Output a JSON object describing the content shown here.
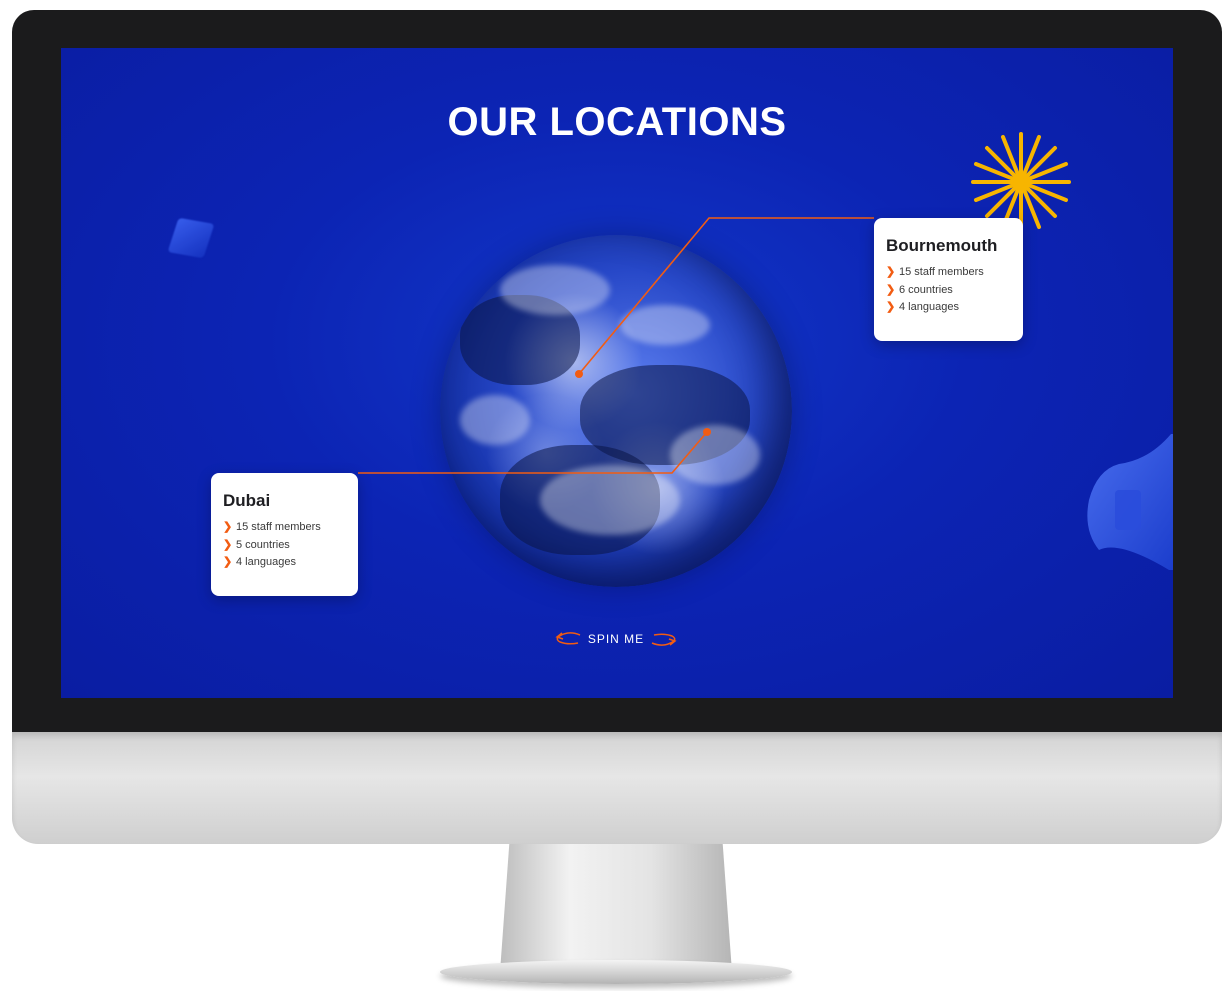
{
  "page": {
    "title": "OUR LOCATIONS"
  },
  "locations": [
    {
      "name": "Bournemouth",
      "stats": [
        "15 staff members",
        "6 countries",
        "4 languages"
      ]
    },
    {
      "name": "Dubai",
      "stats": [
        "15 staff members",
        "5 countries",
        "4 languages"
      ]
    }
  ],
  "spin": {
    "label": "SPIN ME"
  },
  "icons": {
    "bullet": "chevron-right-icon",
    "spin_left": "rotate-arrow-left-icon",
    "spin_right": "rotate-arrow-right-icon",
    "sun": "sunburst-icon",
    "megaphone": "megaphone-icon",
    "cube": "cube-icon"
  },
  "colors": {
    "screen_bg": "#0c24b4",
    "accent": "#f25c12",
    "sun": "#f7b500",
    "card_bg": "#ffffff"
  }
}
